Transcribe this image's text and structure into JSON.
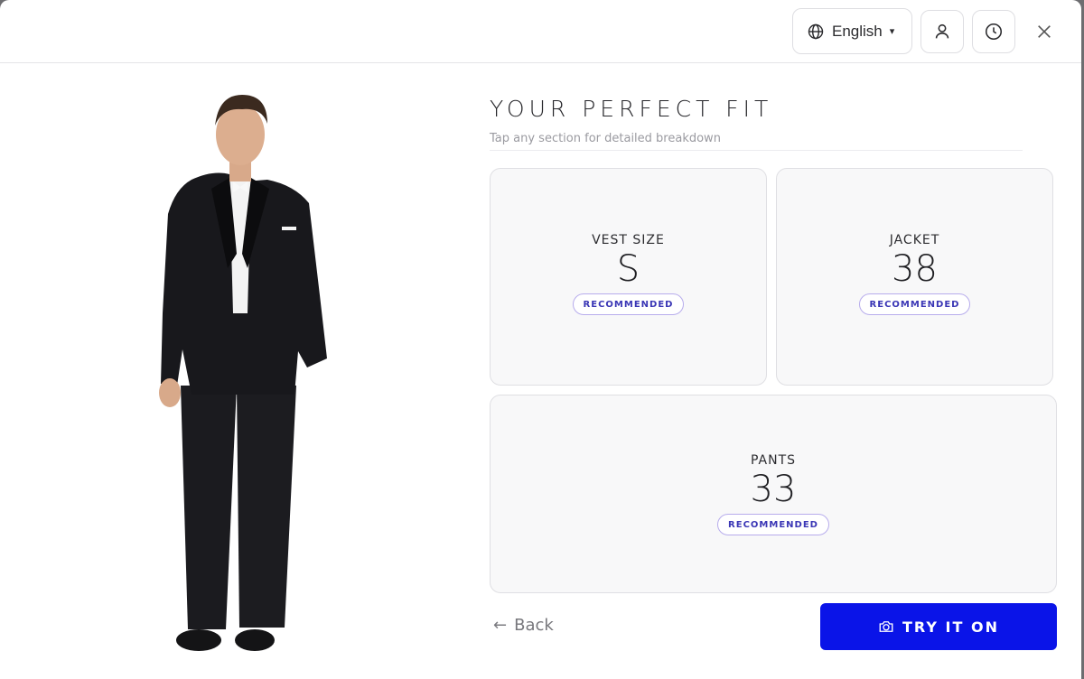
{
  "header": {
    "language_label": "English",
    "language_caret": "▾",
    "icons": {
      "globe": "globe-icon",
      "profile": "user-icon",
      "history": "clock-icon",
      "close": "close-icon"
    }
  },
  "model": {
    "image": "model-in-black-tuxedo"
  },
  "fit": {
    "title": "YOUR PERFECT FIT",
    "subtitle": "Tap any section for detailed breakdown",
    "cards": [
      {
        "label": "VEST SIZE",
        "value": "S",
        "badge": "RECOMMENDED"
      },
      {
        "label": "JACKET",
        "value": "38",
        "badge": "RECOMMENDED"
      },
      {
        "label": "PANTS",
        "value": "33",
        "badge": "RECOMMENDED"
      }
    ]
  },
  "footer": {
    "back_arrow": "←",
    "back_label": "Back",
    "try_label": "TRY IT ON",
    "try_icon": "camera-icon"
  },
  "colors": {
    "accent": "#0a14e8",
    "badge_text": "#3a36b5",
    "badge_border": "#b7acec",
    "card_bg": "#f8f8f9"
  }
}
